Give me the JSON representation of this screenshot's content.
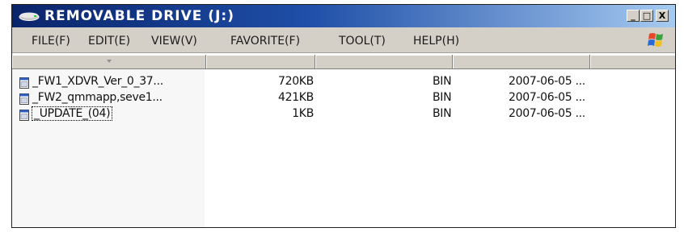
{
  "window": {
    "title": "REMOVABLE DRIVE (J:)",
    "controls": {
      "minimize": "_",
      "maximize": "□",
      "close": "X"
    }
  },
  "menu": {
    "items": [
      "FILE(F)",
      "EDIT(E)",
      "VIEW(V)",
      "FAVORITE(F)",
      "TOOL(T)",
      "HELP(H)"
    ]
  },
  "files": [
    {
      "name": "_FW1_XDVR_Ver_0_37...",
      "size": "720KB",
      "type": "BIN",
      "date": "2007-06-05 ..."
    },
    {
      "name": "_FW2_qmmapp,seve1...",
      "size": "421KB",
      "type": "BIN",
      "date": "2007-06-05 ..."
    },
    {
      "name": "_UPDATE_(04)",
      "size": "1KB",
      "type": "BIN",
      "date": "2007-06-05 ...",
      "selected": true
    }
  ],
  "colors": {
    "titlebar_start": "#0a246a",
    "titlebar_end": "#a6caf0",
    "chrome": "#d4d0c8"
  },
  "icons": {
    "title": "drive-icon",
    "file": "bin-file-icon",
    "brand": "windows-flag-icon"
  }
}
